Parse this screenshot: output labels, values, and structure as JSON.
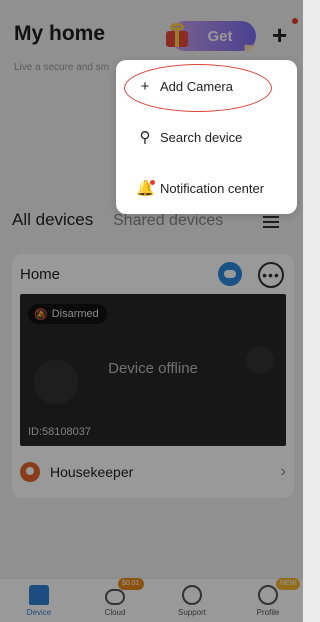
{
  "header": {
    "title": "My home",
    "subtitle": "Live a secure and sm",
    "promo_label": "Get"
  },
  "tabs": {
    "all": "All devices",
    "shared": "Shared devices"
  },
  "device_card": {
    "name": "Home",
    "status_badge": "Disarmed",
    "preview_status": "Device offline",
    "device_id": "ID:58108037",
    "housekeeper_label": "Housekeeper"
  },
  "bottom_nav": {
    "device": "Device",
    "cloud": "Cloud",
    "cloud_badge": "$0.01",
    "support": "Support",
    "profile": "Profile",
    "profile_badge": "NEW"
  },
  "popup_menu": {
    "add_camera": "Add Camera",
    "search_device": "Search device",
    "notification_center": "Notification center"
  },
  "colors": {
    "accent": "#2f7fd6",
    "highlight": "#d9423b",
    "notification_dot": "#ea3a2e"
  },
  "icons": [
    "gift-icon",
    "plus-icon",
    "menu-icon",
    "cloud-storage-icon",
    "more-icon",
    "bell-off-icon",
    "housekeeper-icon",
    "chevron-right-icon",
    "device-icon",
    "cloud-icon",
    "support-icon",
    "profile-icon",
    "search-icon",
    "bell-icon"
  ]
}
